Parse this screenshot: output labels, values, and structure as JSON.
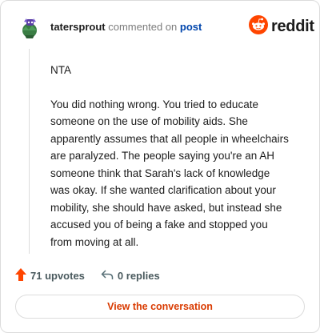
{
  "header": {
    "username": "tatersprout",
    "verb": "commented on",
    "post_link": "post",
    "brand": "reddit"
  },
  "comment": {
    "paragraphs": [
      "NTA",
      "You did nothing wrong. You tried to educate someone on the use of mobility aids. She apparently assumes that all people in wheelchairs are paralyzed. The people saying you're an AH someone think that Sarah's lack of knowledge was okay. If she wanted clarification about your mobility, she should have asked, but instead she accused you of being a fake and stopped you from moving at all."
    ]
  },
  "footer": {
    "upvotes": "71 upvotes",
    "replies": "0 replies"
  },
  "cta": {
    "label": "View the conversation"
  },
  "colors": {
    "brand_orange": "#ff4500",
    "link_blue": "#0045ac",
    "cta_text": "#d93a00"
  },
  "icons": [
    "avatar",
    "reddit-logo-icon",
    "upvote-arrow-icon",
    "reply-icon"
  ]
}
